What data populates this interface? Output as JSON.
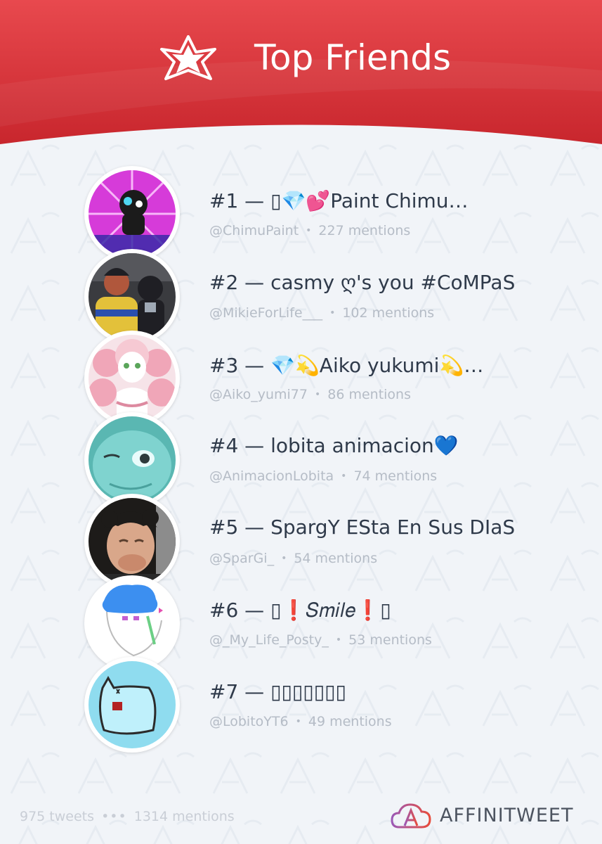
{
  "header": {
    "title": "Top Friends",
    "star_icon": "star-outline-icon",
    "color_top": "#e8444a",
    "color_bottom": "#c8262d"
  },
  "friends": [
    {
      "rank_name": "#1 — ▯💎💕Paint Chimu…",
      "handle": "@ChimuPaint",
      "mentions": "227 mentions",
      "avatar_palette": [
        "#d63bd9",
        "#3a2aa8",
        "#ffd7ff",
        "#1b1b1b"
      ]
    },
    {
      "rank_name": "#2 — casmy ღ's you #CoMPaS",
      "handle": "@MikieForLife___",
      "mentions": "102 mentions",
      "avatar_palette": [
        "#3a3b3f",
        "#e3c13a",
        "#b0573c",
        "#1f1f24"
      ]
    },
    {
      "rank_name": "#3 — 💎💫Aiko yukumi💫…",
      "handle": "@Aiko_yumi77",
      "mentions": "86 mentions",
      "avatar_palette": [
        "#f6c9d3",
        "#f0a6b8",
        "#ffffff",
        "#dd8aa0"
      ]
    },
    {
      "rank_name": "#4 — lobita animacion💙",
      "handle": "@AnimacionLobita",
      "mentions": "74 mentions",
      "avatar_palette": [
        "#7fd3cf",
        "#5ab7b2",
        "#e9fbfb",
        "#2e3b3c"
      ]
    },
    {
      "rank_name": "#5 — SpargY ESta En Sus DIaS",
      "handle": "@SparGi_",
      "mentions": "54 mentions",
      "avatar_palette": [
        "#1d1b19",
        "#d9a78a",
        "#5a3f2e",
        "#8c8c8c"
      ]
    },
    {
      "rank_name": "#6 — ▯❗𝑆𝑚𝑖𝑙𝑒❗▯",
      "handle": "@_My_Life_Posty_",
      "mentions": "53 mentions",
      "avatar_palette": [
        "#ffffff",
        "#3c8ff0",
        "#6ccf85",
        "#c35fd1"
      ]
    },
    {
      "rank_name": "#7 — ▯▯▯▯▯▯▯",
      "handle": "@LobitoYT6",
      "mentions": "49 mentions",
      "avatar_palette": [
        "#8fdcef",
        "#2b2b2b",
        "#b32222",
        "#bff0fb"
      ]
    }
  ],
  "footer": {
    "tweets": "975 tweets",
    "separator": "•••",
    "mentions": "1314 mentions",
    "brand": "AFFINITWEET",
    "brand_icon": "affinitweet-cloud-logo",
    "brand_colors": [
      "#9b59b6",
      "#e74c3c"
    ]
  }
}
